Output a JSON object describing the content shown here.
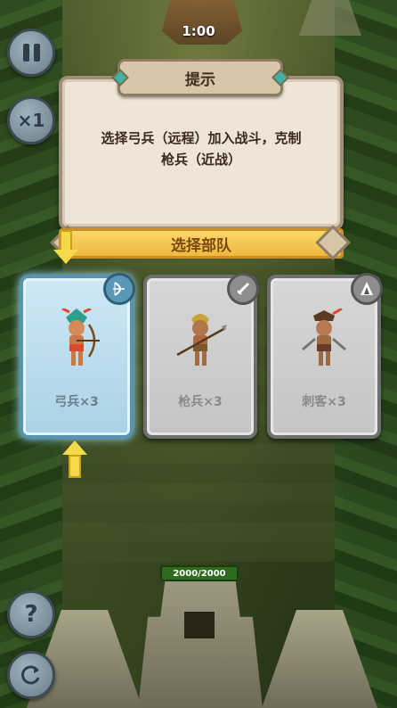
{
  "hud": {
    "timer": "1:00",
    "pause_icon": "pause-icon",
    "speed_label": "×1",
    "help_label": "?",
    "refresh_icon": "refresh-icon"
  },
  "dialog": {
    "title": "提示",
    "message_line1": "选择弓兵（远程）加入战斗，克制",
    "message_line2": "枪兵（近战）"
  },
  "banner": {
    "title": "选择部队"
  },
  "cards": [
    {
      "label": "弓兵×3",
      "badge_icon": "bow-icon",
      "selected": true
    },
    {
      "label": "枪兵×3",
      "badge_icon": "sword-icon",
      "selected": false
    },
    {
      "label": "刺客×3",
      "badge_icon": "hood-icon",
      "selected": false
    }
  ],
  "base": {
    "hp_text": "2000/2000"
  },
  "colors": {
    "accent_gold": "#f4d94a",
    "selected_card": "#a9d2e6",
    "hp_green": "#2e6b1e"
  }
}
